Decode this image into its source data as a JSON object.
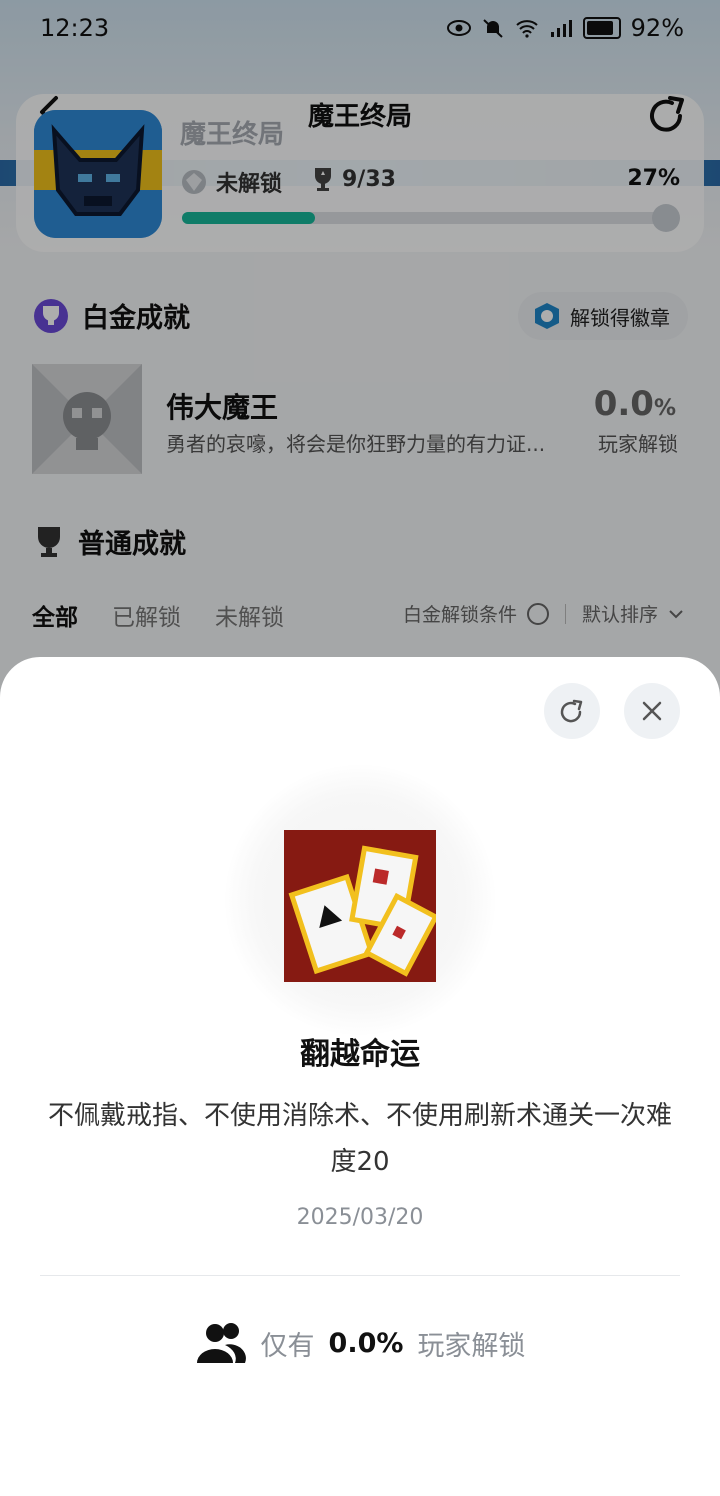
{
  "status_bar": {
    "time": "12:23",
    "battery": "92%"
  },
  "header": {
    "title": "魔王终局"
  },
  "game": {
    "name": "魔王终局",
    "lock_status": "未解锁",
    "trophy_count": "9/33",
    "progress_percent_label": "27%",
    "progress_fraction": 0.27
  },
  "platinum_section": {
    "title": "白金成就",
    "badge_button": "解锁得徽章",
    "achievement": {
      "name": "伟大魔王",
      "description": "勇者的哀嚎，将会是你狂野力量的有力证...",
      "rate_value": "0.0",
      "rate_unit": "%",
      "rate_label": "玩家解锁"
    }
  },
  "normal_section": {
    "title": "普通成就",
    "tabs": [
      "全部",
      "已解锁",
      "未解锁"
    ],
    "filter_condition": "白金解锁条件",
    "sort_label": "默认排序"
  },
  "sheet": {
    "title": "翻越命运",
    "description": "不佩戴戒指、不使用消除术、不使用刷新术通关一次难度20",
    "date": "2025/03/20",
    "players_prefix": "仅有",
    "players_rate": "0.0%",
    "players_suffix": "玩家解锁"
  },
  "colors": {
    "accent": "#17b79a",
    "card_red": "#861a12"
  }
}
